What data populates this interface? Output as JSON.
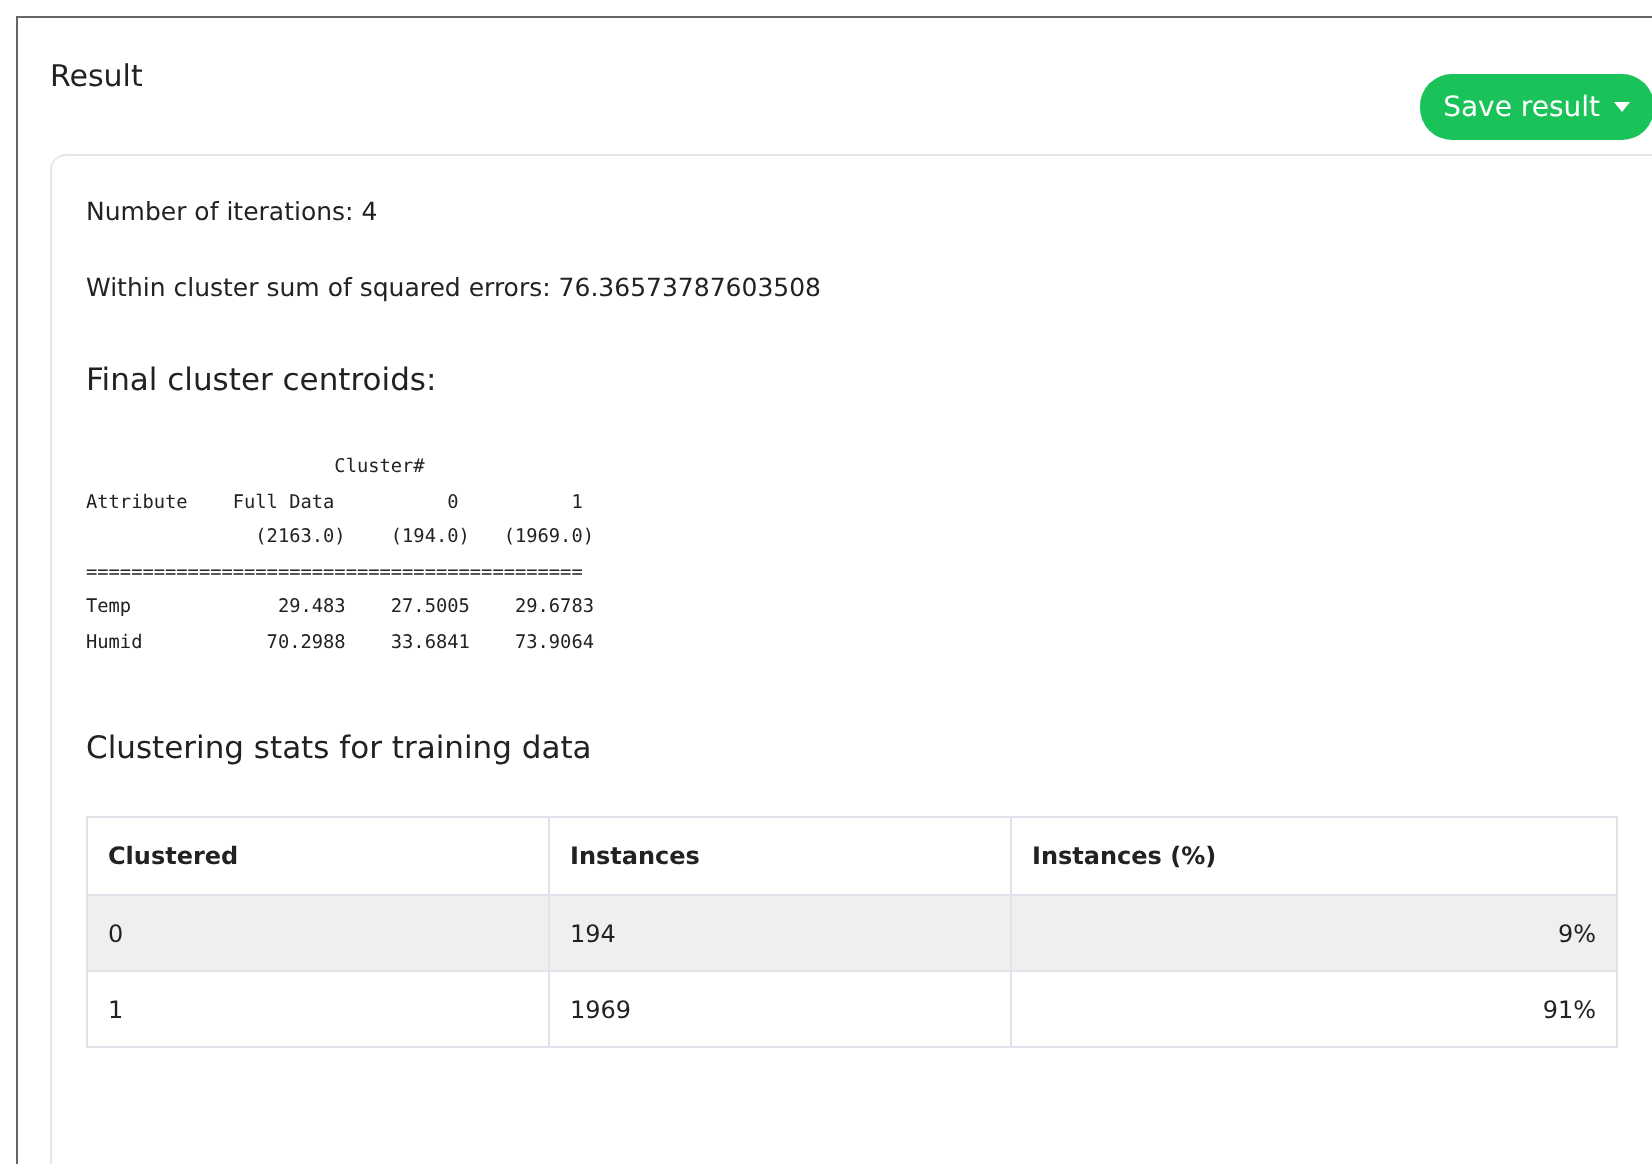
{
  "title": "Result",
  "save_button": {
    "label": "Save result"
  },
  "summary": [
    "Number of iterations: 4",
    "Within cluster sum of squared errors: 76.36573787603508"
  ],
  "centroids": {
    "heading": "Final cluster centroids:",
    "lines": [
      "                      Cluster#",
      "Attribute    Full Data          0          1",
      "               (2163.0)    (194.0)   (1969.0)",
      "============================================",
      "Temp             29.483    27.5005    29.6783",
      "Humid           70.2988    33.6841    73.9064"
    ]
  },
  "stats": {
    "heading": "Clustering stats for training data",
    "columns": [
      "Clustered",
      "Instances",
      "Instances (%)"
    ],
    "rows": [
      [
        "0",
        "194",
        "9%"
      ],
      [
        "1",
        "1969",
        "91%"
      ]
    ]
  }
}
